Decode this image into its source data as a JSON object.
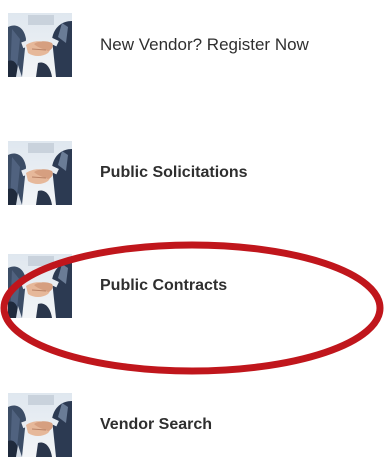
{
  "menu": {
    "items": [
      {
        "label": "New Vendor? Register Now",
        "icon": "handshake-icon"
      },
      {
        "label": "Public Solicitations",
        "icon": "handshake-icon"
      },
      {
        "label": "Public Contracts",
        "icon": "handshake-icon",
        "highlighted": true
      },
      {
        "label": "Vendor Search",
        "icon": "handshake-icon"
      }
    ]
  },
  "colors": {
    "highlight": "#c0161c",
    "text": "#2f2f2f"
  }
}
